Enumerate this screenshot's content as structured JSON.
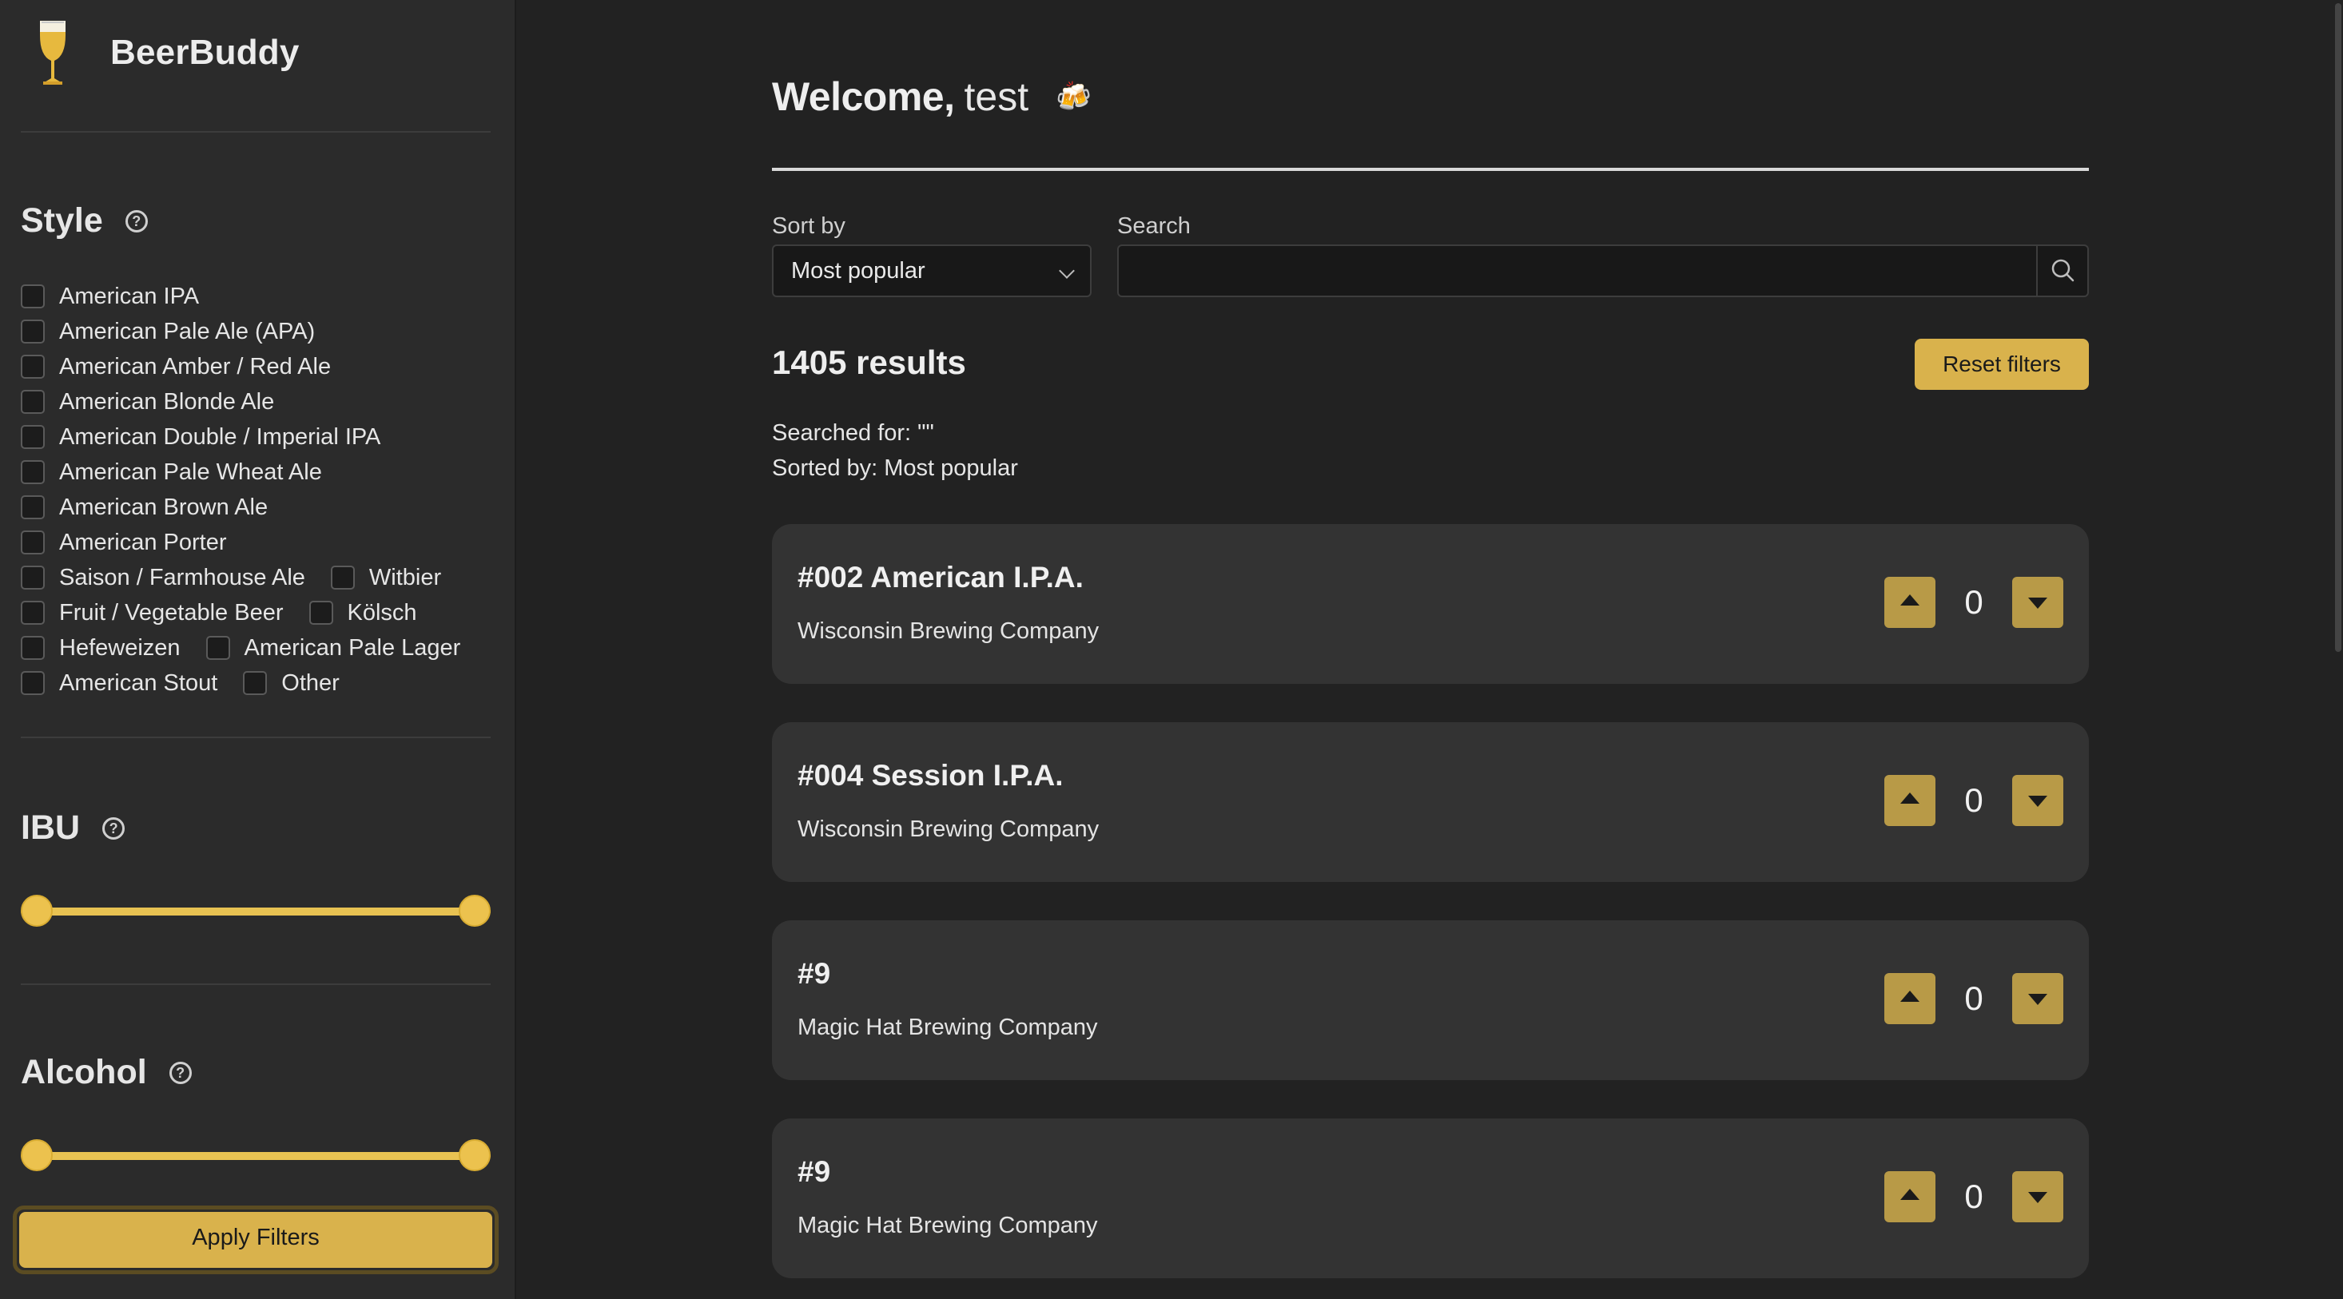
{
  "app": {
    "name": "BeerBuddy"
  },
  "sidebar": {
    "style": {
      "title": "Style",
      "rows": [
        [
          "American IPA"
        ],
        [
          "American Pale Ale (APA)"
        ],
        [
          "American Amber / Red Ale"
        ],
        [
          "American Blonde Ale"
        ],
        [
          "American Double / Imperial IPA"
        ],
        [
          "American Pale Wheat Ale"
        ],
        [
          "American Brown Ale"
        ],
        [
          "American Porter"
        ],
        [
          "Saison / Farmhouse Ale",
          "Witbier"
        ],
        [
          "Fruit / Vegetable Beer",
          "Kölsch"
        ],
        [
          "Hefeweizen",
          "American Pale Lager"
        ],
        [
          "American Stout",
          "Other"
        ]
      ]
    },
    "ibu": {
      "title": "IBU",
      "range_fraction": [
        0,
        1
      ]
    },
    "alcohol": {
      "title": "Alcohol",
      "range_fraction": [
        0,
        1
      ]
    },
    "apply_label": "Apply Filters"
  },
  "main": {
    "welcome_prefix": "Welcome,",
    "username": "test",
    "beer_emoji": "🍻",
    "sort_label": "Sort by",
    "sort_value": "Most popular",
    "search_label": "Search",
    "search_value": "",
    "results_text": "1405 results",
    "reset_label": "Reset filters",
    "searched_for": "Searched for: \"\"",
    "sorted_by": "Sorted by: Most popular",
    "beers": [
      {
        "name": "#002 American I.P.A.",
        "brewery": "Wisconsin Brewing Company",
        "votes": "0"
      },
      {
        "name": "#004 Session I.P.A.",
        "brewery": "Wisconsin Brewing Company",
        "votes": "0"
      },
      {
        "name": "#9",
        "brewery": "Magic Hat Brewing Company",
        "votes": "0"
      },
      {
        "name": "#9",
        "brewery": "Magic Hat Brewing Company",
        "votes": "0"
      }
    ]
  },
  "colors": {
    "accent": "#d9b24c",
    "background": "#222222",
    "sidebar": "#2b2b2b",
    "card": "#333333"
  },
  "icons": [
    "beer-glass-icon",
    "help-icon",
    "search-icon",
    "chevron-down-icon",
    "arrow-up-icon",
    "arrow-down-icon"
  ]
}
